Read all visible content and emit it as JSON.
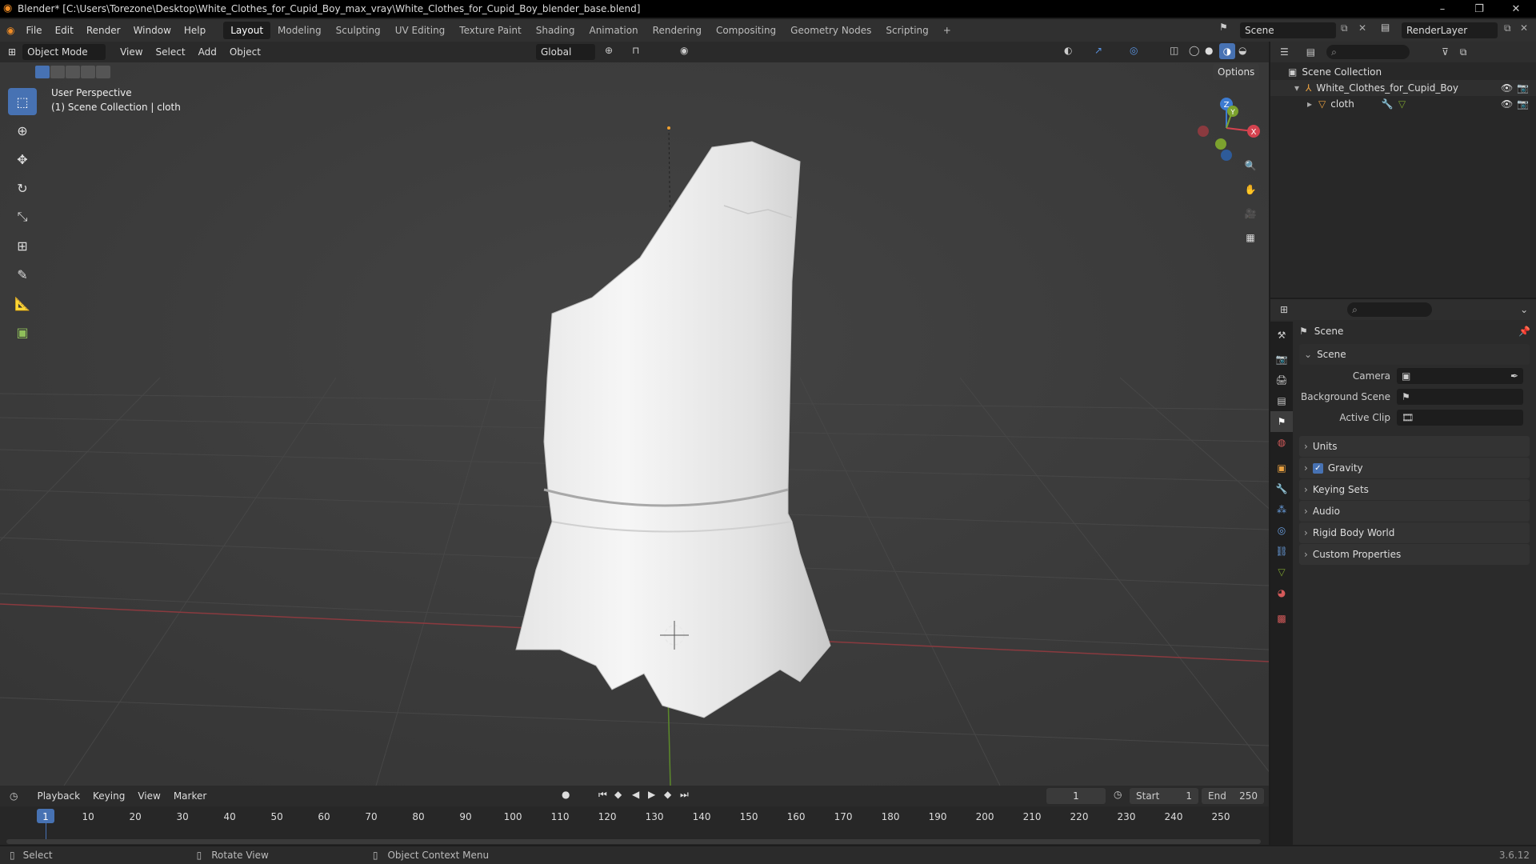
{
  "window": {
    "title": "Blender* [C:\\Users\\Torezone\\Desktop\\White_Clothes_for_Cupid_Boy_max_vray\\White_Clothes_for_Cupid_Boy_blender_base.blend]",
    "minimize": "–",
    "maximize": "❐",
    "close": "✕"
  },
  "menus": [
    "File",
    "Edit",
    "Render",
    "Window",
    "Help"
  ],
  "workspaces": [
    "Layout",
    "Modeling",
    "Sculpting",
    "UV Editing",
    "Texture Paint",
    "Shading",
    "Animation",
    "Rendering",
    "Compositing",
    "Geometry Nodes",
    "Scripting",
    "+"
  ],
  "scene_selector": {
    "value": "Scene",
    "view_layer": "RenderLayer"
  },
  "viewport_header": {
    "mode": "Object Mode",
    "menus": [
      "View",
      "Select",
      "Add",
      "Object"
    ],
    "orientation": "Global",
    "options": "Options"
  },
  "viewport": {
    "perspective": "User Perspective",
    "collection_info": "(1) Scene Collection | cloth",
    "axis_x": "X",
    "axis_y": "Y",
    "axis_z": "Z"
  },
  "outliner": {
    "root": "Scene Collection",
    "items": [
      {
        "name": "White_Clothes_for_Cupid_Boy"
      },
      {
        "name": "cloth"
      }
    ]
  },
  "properties": {
    "header": "Scene",
    "panel": "Scene",
    "fields": [
      {
        "label": "Camera",
        "value": ""
      },
      {
        "label": "Background Scene",
        "value": ""
      },
      {
        "label": "Active Clip",
        "value": ""
      }
    ],
    "sections": [
      "Units",
      "Gravity",
      "Keying Sets",
      "Audio",
      "Rigid Body World",
      "Custom Properties"
    ],
    "gravity_checked": true
  },
  "timeline": {
    "menus": [
      "Playback",
      "Keying",
      "View",
      "Marker"
    ],
    "current_frame": "1",
    "start_label": "Start",
    "start": "1",
    "end_label": "End",
    "end": "250",
    "ticks": [
      "1",
      "10",
      "20",
      "30",
      "40",
      "50",
      "60",
      "70",
      "80",
      "90",
      "100",
      "110",
      "120",
      "130",
      "140",
      "150",
      "160",
      "170",
      "180",
      "190",
      "200",
      "210",
      "220",
      "230",
      "240",
      "250"
    ]
  },
  "statusbar": {
    "select": "Select",
    "rotate": "Rotate View",
    "context": "Object Context Menu",
    "version": "3.6.12"
  },
  "colors": {
    "accent": "#4772b3",
    "x_axis": "#d4434f",
    "y_axis": "#7ca22e",
    "z_axis": "#3d7bd1"
  }
}
